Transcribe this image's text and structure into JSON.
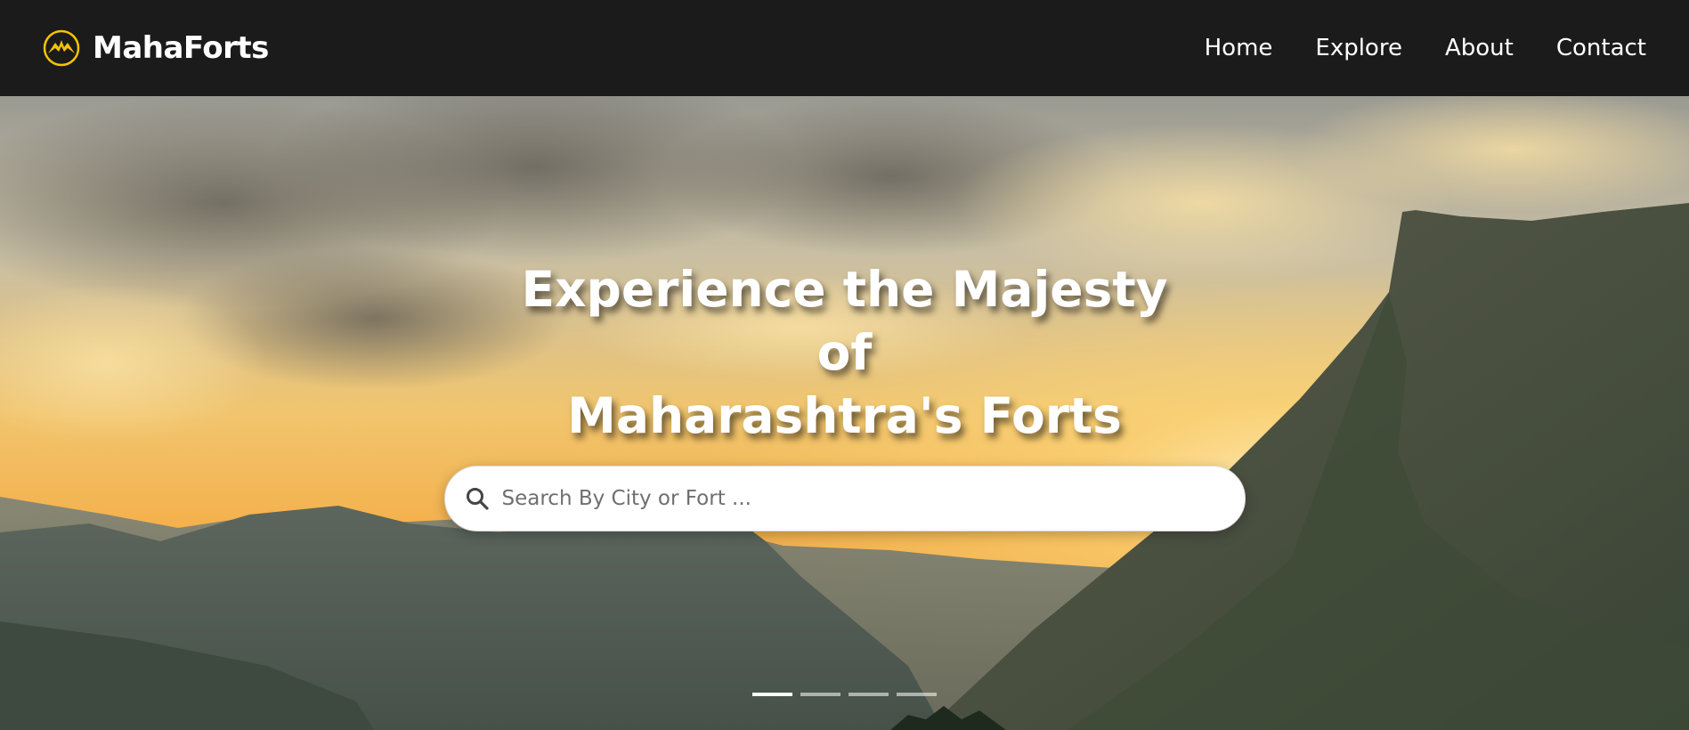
{
  "brand": {
    "name": "MahaForts",
    "logo_icon": "mountain-logo-icon",
    "logo_color": "#f5c400"
  },
  "nav": {
    "links": [
      {
        "label": "Home"
      },
      {
        "label": "Explore"
      },
      {
        "label": "About"
      },
      {
        "label": "Contact"
      }
    ]
  },
  "hero": {
    "title_line1": "Experience the Majesty of",
    "title_line2": "Maharashtra's Forts",
    "background_icon": "sunset-mountain-image"
  },
  "search": {
    "placeholder": "Search By City or Fort ...",
    "value": "",
    "icon": "search-icon"
  },
  "carousel": {
    "slide_count": 4,
    "active_index": 0
  },
  "colors": {
    "navbar_bg": "#1b1b1b",
    "nav_text": "#ffffff",
    "accent": "#f5c400"
  }
}
